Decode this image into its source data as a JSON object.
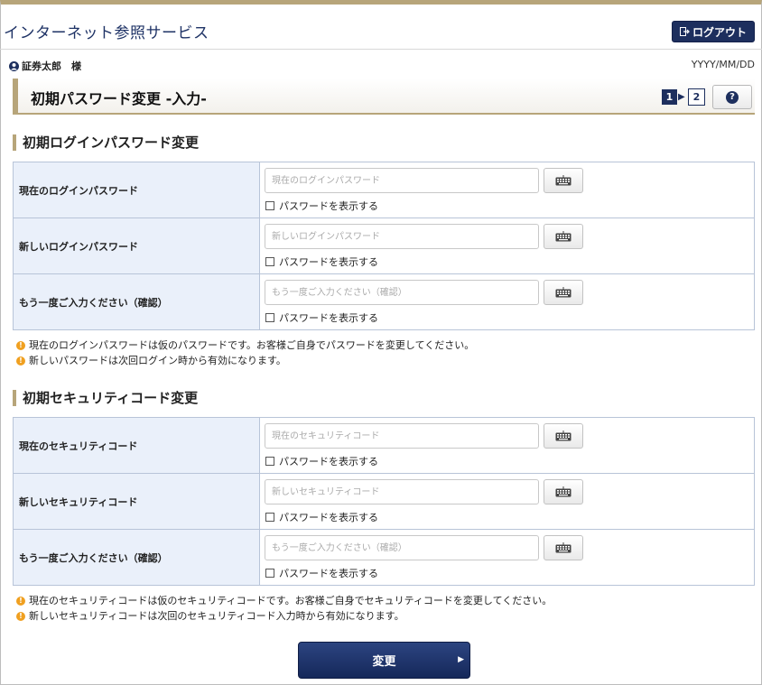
{
  "header": {
    "app_title": "インターネット参照サービス",
    "logout_label": "ログアウト"
  },
  "userbar": {
    "user_name": "証券太郎　様",
    "date": "YYYY/MM/DD"
  },
  "page": {
    "title": "初期パスワード変更 -入力-",
    "step_current": "1",
    "step_next": "2",
    "help_label": "?"
  },
  "login_section": {
    "title": "初期ログインパスワード変更",
    "rows": [
      {
        "label": "現在のログインパスワード",
        "placeholder": "現在のログインパスワード",
        "value": "",
        "show_label": "パスワードを表示する"
      },
      {
        "label": "新しいログインパスワード",
        "placeholder": "新しいログインパスワード",
        "value": "",
        "show_label": "パスワードを表示する"
      },
      {
        "label": "もう一度ご入力ください（確認）",
        "placeholder": "もう一度ご入力ください（確認）",
        "value": "",
        "show_label": "パスワードを表示する"
      }
    ],
    "notes": [
      "現在のログインパスワードは仮のパスワードです。お客様ご自身でパスワードを変更してください。",
      "新しいパスワードは次回ログイン時から有効になります。"
    ]
  },
  "security_section": {
    "title": "初期セキュリティコード変更",
    "rows": [
      {
        "label": "現在のセキュリティコード",
        "placeholder": "現在のセキュリティコード",
        "value": "",
        "show_label": "パスワードを表示する"
      },
      {
        "label": "新しいセキュリティコード",
        "placeholder": "新しいセキュリティコード",
        "value": "",
        "show_label": "パスワードを表示する"
      },
      {
        "label": "もう一度ご入力ください（確認）",
        "placeholder": "もう一度ご入力ください（確認）",
        "value": "",
        "show_label": "パスワードを表示する"
      }
    ],
    "notes": [
      "現在のセキュリティコードは仮のセキュリティコードです。お客様ご自身でセキュリティコードを変更してください。",
      "新しいセキュリティコードは次回のセキュリティコード入力時から有効になります。"
    ]
  },
  "submit": {
    "label": "変更"
  },
  "icons": {
    "logout": "logout-icon",
    "user": "user-icon",
    "help": "help-icon",
    "keyboard": "keyboard-icon",
    "warning": "warning-icon",
    "arrow": "arrow-right-icon"
  },
  "colors": {
    "accent_gold": "#b7a57a",
    "navy": "#1d2f5e",
    "label_bg": "#eaf0fa",
    "warning": "#f0a020"
  }
}
